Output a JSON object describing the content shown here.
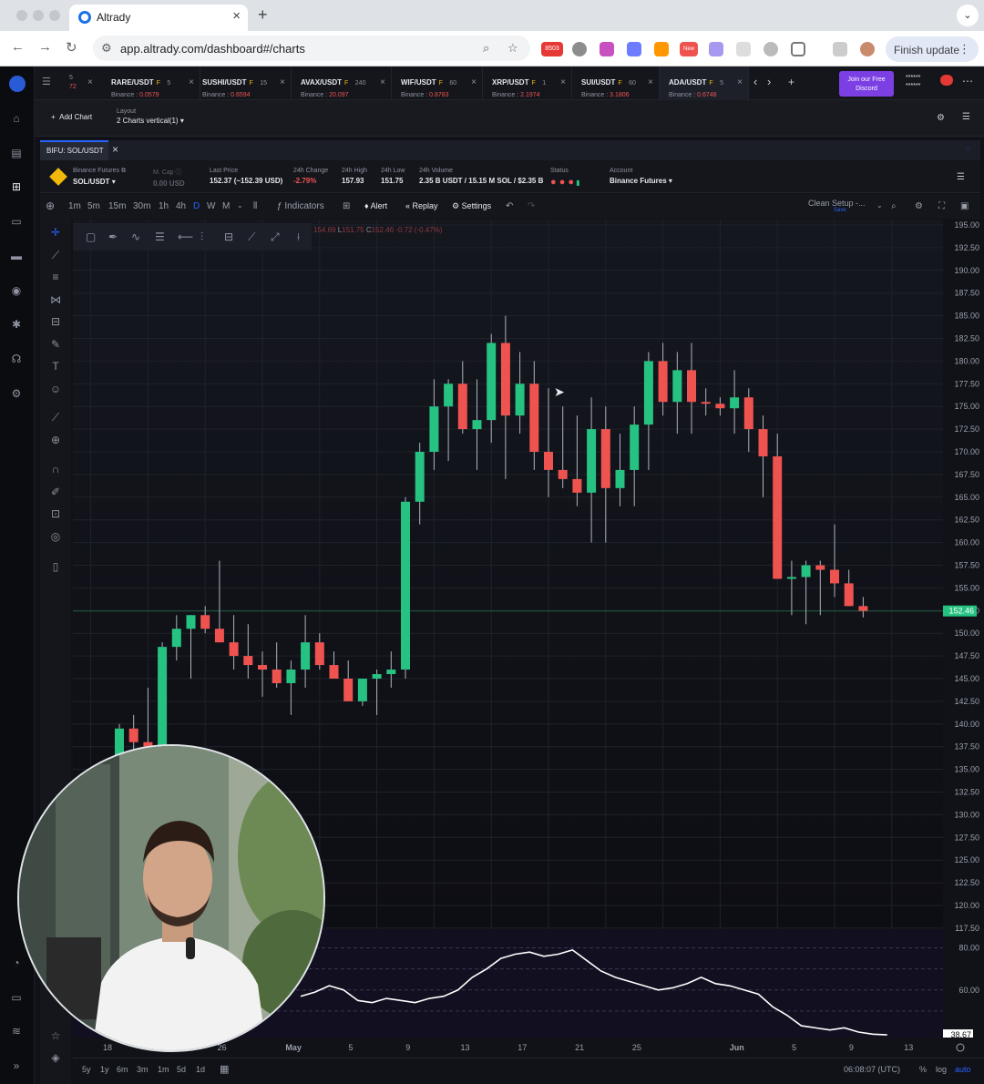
{
  "browser": {
    "tab_title": "Altrady",
    "url": "app.altrady.com/dashboard#/charts",
    "finish_update": "Finish update",
    "ext_badge_1": "8503",
    "ext_badge_2": "New"
  },
  "pair_tabs": [
    {
      "name": "RARE/USDT",
      "lev": "5",
      "exchange": "Binance :",
      "price": "0.0579"
    },
    {
      "name": "SUSHI/USDT",
      "lev": "15",
      "exchange": "Binance :",
      "price": "0.6594"
    },
    {
      "name": "AVAX/USDT",
      "lev": "240",
      "exchange": "Binance :",
      "price": "20.097"
    },
    {
      "name": "WIF/USDT",
      "lev": "60",
      "exchange": "Binance :",
      "price": "0.8783"
    },
    {
      "name": "XRP/USDT",
      "lev": "1",
      "exchange": "Binance :",
      "price": "2.1974"
    },
    {
      "name": "SUI/USDT",
      "lev": "60",
      "exchange": "Binance :",
      "price": "3.1806"
    },
    {
      "name": "ADA/USDT",
      "lev": "5",
      "exchange": "Binance :",
      "price": "0.6748"
    }
  ],
  "first_tab_partial": {
    "top": "5",
    "bottom": "72"
  },
  "futures_flag": "F",
  "discord": {
    "line1": "Join our Free",
    "line2": "Discord"
  },
  "masked_user": "******",
  "toolbar": {
    "add_chart": "Add Chart",
    "layout_label": "Layout",
    "layout_value": "2 Charts vertical(1)"
  },
  "panel": {
    "tab": "BIFU: SOL/USDT"
  },
  "info": {
    "exchange": "Binance Futures",
    "pair": "SOL/USDT",
    "mcap_label": "M. Cap",
    "mcap_value": "0.00 USD",
    "last_label": "Last Price",
    "last_value": "152.37 (~152.39 USD)",
    "chg_label": "24h Change",
    "chg_value": "-2.79%",
    "high_label": "24h High",
    "high_value": "157.93",
    "low_label": "24h Low",
    "low_value": "151.75",
    "vol_label": "24h Volume",
    "vol_value": "2.35 B USDT / 15.15 M SOL / $2.35 B",
    "status_label": "Status",
    "account_label": "Account",
    "account_value": "Binance Futures"
  },
  "timeframes": [
    "1m",
    "5m",
    "15m",
    "30m",
    "1h",
    "4h",
    "D",
    "W",
    "M"
  ],
  "active_timeframe": "D",
  "chart_toolbar": {
    "indicators": "Indicators",
    "alert": "Alert",
    "replay": "Replay",
    "settings": "Settings",
    "clean_setup": "Clean Setup -...",
    "save": "Save"
  },
  "ohlc_text": {
    "o": "154.69",
    "l_label": "L",
    "l": "151.75",
    "c_label": "C",
    "c": "152.46",
    "chg": "-0.72 (-0.47%)"
  },
  "periods": [
    "5y",
    "1y",
    "6m",
    "3m",
    "1m",
    "5d",
    "1d"
  ],
  "bottom": {
    "time": "06:08:07 (UTC)",
    "pct": "%",
    "log": "log",
    "auto": "auto"
  },
  "chart_data": {
    "type": "candlestick",
    "y_ticks": [
      "195.00",
      "192.50",
      "190.00",
      "187.50",
      "185.00",
      "182.50",
      "180.00",
      "177.50",
      "175.00",
      "172.50",
      "170.00",
      "167.50",
      "165.00",
      "162.50",
      "160.00",
      "157.50",
      "155.00",
      "152.50",
      "150.00",
      "147.50",
      "145.00",
      "142.50",
      "140.00",
      "137.50",
      "135.00",
      "132.50",
      "130.00",
      "127.50",
      "125.00",
      "122.50",
      "120.00",
      "117.50"
    ],
    "ylim": [
      117.5,
      195
    ],
    "x_labels": [
      "18",
      "26",
      "May",
      "5",
      "9",
      "13",
      "17",
      "21",
      "25",
      "Jun",
      "5",
      "9",
      "13"
    ],
    "x_label_day_index": [
      0,
      8,
      13,
      17,
      21,
      25,
      29,
      33,
      37,
      44,
      48,
      52,
      56
    ],
    "last_price": "152.46",
    "candles": [
      [
        134,
        140,
        130,
        139.5
      ],
      [
        139.5,
        141,
        137,
        138
      ],
      [
        138,
        144,
        136,
        137.5
      ],
      [
        137.5,
        149,
        137,
        148.5
      ],
      [
        148.5,
        152,
        147,
        150.5
      ],
      [
        150.5,
        152,
        145,
        152
      ],
      [
        152,
        153,
        150,
        150.5
      ],
      [
        150.5,
        158,
        149,
        149
      ],
      [
        149,
        152,
        146,
        147.5
      ],
      [
        147.5,
        151,
        145,
        146.5
      ],
      [
        146.5,
        148,
        143,
        146
      ],
      [
        146,
        149,
        144,
        144.5
      ],
      [
        144.5,
        147,
        141,
        146
      ],
      [
        146,
        152,
        144,
        149
      ],
      [
        149,
        150,
        146,
        146.5
      ],
      [
        146.5,
        148,
        145,
        145
      ],
      [
        145,
        147,
        143,
        142.5
      ],
      [
        142.5,
        145,
        142,
        145
      ],
      [
        145,
        146,
        141,
        145.5
      ],
      [
        145.5,
        148,
        144,
        146
      ],
      [
        146,
        165,
        145,
        164.5
      ],
      [
        164.5,
        171,
        162,
        170
      ],
      [
        170,
        178,
        168,
        175
      ],
      [
        175,
        178,
        169,
        177.5
      ],
      [
        177.5,
        180,
        172,
        172.5
      ],
      [
        172.5,
        178,
        168,
        173.5
      ],
      [
        173.5,
        183,
        171,
        182
      ],
      [
        182,
        185,
        167,
        174
      ],
      [
        174,
        181,
        172,
        177.5
      ],
      [
        177.5,
        180,
        168,
        170
      ],
      [
        170,
        177,
        165,
        168
      ],
      [
        168,
        175,
        166,
        167
      ],
      [
        167,
        174,
        164,
        165.5
      ],
      [
        165.5,
        176,
        160,
        172.5
      ],
      [
        172.5,
        175,
        160,
        166
      ],
      [
        166,
        172,
        164,
        168
      ],
      [
        168,
        175,
        164,
        173
      ],
      [
        173,
        181,
        168,
        180
      ],
      [
        180,
        182,
        174,
        175.5
      ],
      [
        175.5,
        181,
        172,
        179
      ],
      [
        179,
        182,
        172,
        175.5
      ],
      [
        175.5,
        177,
        174,
        175.3
      ],
      [
        175.3,
        176,
        174,
        174.8
      ],
      [
        174.8,
        179,
        172,
        176
      ],
      [
        176,
        177,
        170,
        172.5
      ],
      [
        172.5,
        174,
        165,
        169.5
      ],
      [
        169.5,
        172,
        156,
        156
      ],
      [
        156,
        158,
        152,
        156.2
      ],
      [
        156.2,
        158,
        151,
        157.5
      ],
      [
        157.5,
        158,
        152,
        157
      ],
      [
        157,
        162,
        154,
        155.5
      ],
      [
        155.5,
        157,
        153,
        153
      ],
      [
        153,
        154,
        151.75,
        152.46
      ]
    ],
    "oscillator": {
      "ylim": [
        40,
        85
      ],
      "y_ticks": [
        "80.00",
        "60.00"
      ],
      "current": "38.67",
      "values": [
        57,
        59,
        62,
        60,
        55,
        54,
        56,
        55,
        54,
        56,
        57,
        60,
        66,
        70,
        75,
        77,
        78,
        76,
        77,
        79,
        74,
        69,
        66,
        64,
        62,
        60,
        61,
        63,
        66,
        63,
        62,
        60,
        58,
        52,
        48,
        43,
        42,
        41,
        42,
        40,
        39,
        38.67
      ]
    }
  }
}
